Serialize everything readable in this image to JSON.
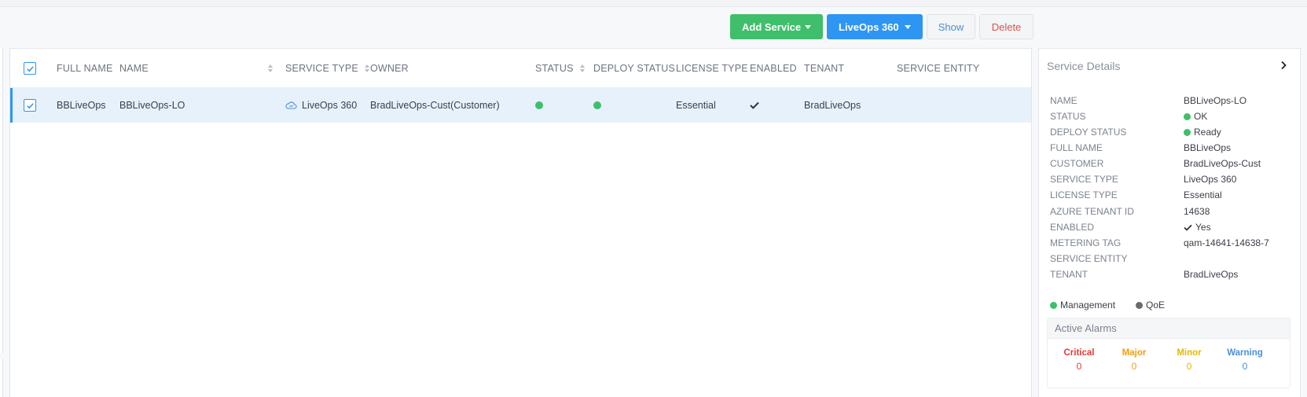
{
  "toolbar": {
    "add_service": "Add Service",
    "liveops": "LiveOps 360",
    "show": "Show",
    "delete": "Delete"
  },
  "table": {
    "headers": {
      "full_name": "FULL NAME",
      "name": "NAME",
      "service_type": "SERVICE TYPE",
      "owner": "OWNER",
      "status": "STATUS",
      "deploy_status": "DEPLOY STATUS",
      "license_type": "LICENSE TYPE",
      "enabled": "ENABLED",
      "tenant": "TENANT",
      "service_entity": "SERVICE ENTITY"
    },
    "rows": [
      {
        "full_name": "BBLiveOps",
        "name": "BBLiveOps-LO",
        "service_type": "LiveOps 360",
        "owner": "BradLiveOps-Cust(Customer)",
        "license_type": "Essential",
        "enabled_icon": "check-icon",
        "tenant": "BradLiveOps",
        "status_color": "#3fbf6b",
        "deploy_color": "#3fbf6b"
      }
    ]
  },
  "details": {
    "title": "Service Details",
    "fields": [
      {
        "label": "NAME",
        "value": "BBLiveOps-LO"
      },
      {
        "label": "STATUS",
        "value": "OK"
      },
      {
        "label": "DEPLOY STATUS",
        "value": "Ready"
      },
      {
        "label": "FULL NAME",
        "value": "BBLiveOps"
      },
      {
        "label": "CUSTOMER",
        "value": "BradLiveOps-Cust"
      },
      {
        "label": "SERVICE TYPE",
        "value": "LiveOps 360"
      },
      {
        "label": "LICENSE TYPE",
        "value": "Essential"
      },
      {
        "label": "AZURE TENANT ID",
        "value": "14638"
      },
      {
        "label": "ENABLED",
        "value": "Yes"
      },
      {
        "label": "METERING TAG",
        "value": "qam-14641-14638-7"
      },
      {
        "label": "SERVICE ENTITY",
        "value": ""
      },
      {
        "label": "TENANT",
        "value": "BradLiveOps"
      }
    ],
    "legend": {
      "management": "Management",
      "qoe": "QoE",
      "management_color": "#3fbf6b",
      "qoe_color": "#6b6b6b"
    }
  },
  "alarms": {
    "title": "Active Alarms",
    "critical_label": "Critical",
    "critical": "0",
    "major_label": "Major",
    "major": "0",
    "minor_label": "Minor",
    "minor": "0",
    "warning_label": "Warning",
    "warning": "0",
    "colors": {
      "critical": "#e53935",
      "major": "#f39c12",
      "minor": "#e6b800",
      "warning": "#4a90d9"
    }
  }
}
